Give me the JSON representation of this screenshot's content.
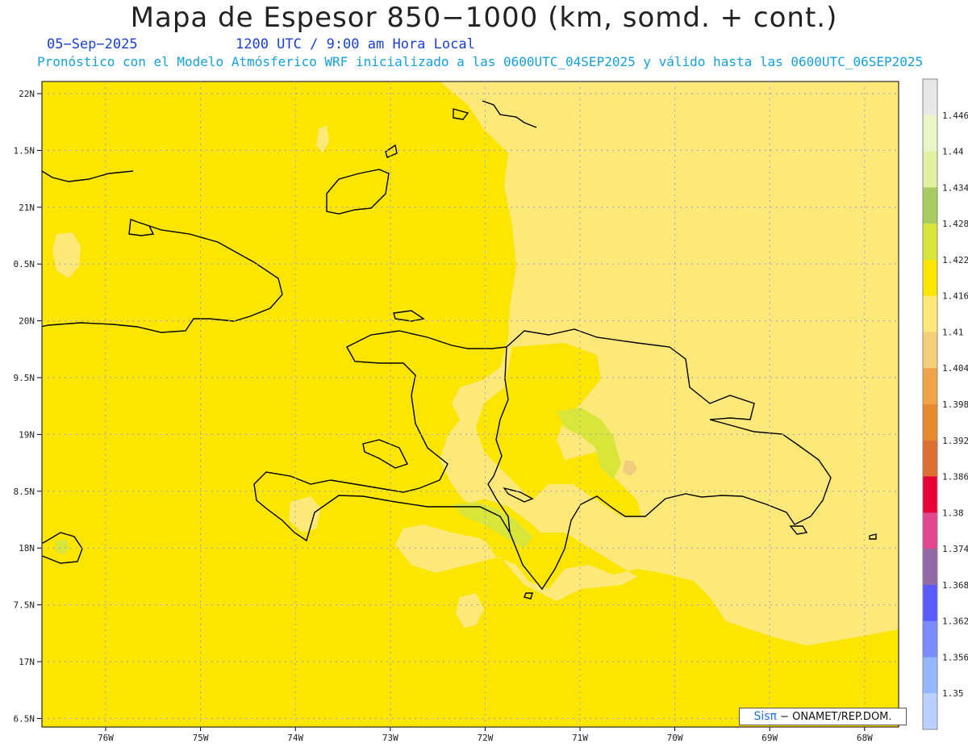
{
  "header": {
    "title": "Mapa de Espesor 850−1000 (km, somd. + cont.)",
    "date": "05−Sep−2025",
    "time": "1200 UTC / 9:00 am Hora Local",
    "subtitle": "Pronóstico con el Modelo Atmósferico WRF inicializado a las 0600UTC_04SEP2025 y válido hasta las  0600UTC_06SEP2025"
  },
  "map": {
    "lat_labels": [
      "22N",
      "1.5N",
      "21N",
      "0.5N",
      "20N",
      "9.5N",
      "19N",
      "8.5N",
      "18N",
      "7.5N",
      "17N",
      "6.5N"
    ],
    "lon_labels": [
      "76W",
      "75W",
      "74W",
      "73W",
      "72W",
      "71W",
      "70W",
      "69W",
      "68W"
    ],
    "fill_colors": {
      "base": "#fce600",
      "light": "#fde97a",
      "green": "#d8e63c",
      "tan": "#f0cc7c"
    }
  },
  "colorbar": {
    "labels": [
      "1.446",
      "1.44",
      "1.434",
      "1.428",
      "1.422",
      "1.416",
      "1.41",
      "1.404",
      "1.398",
      "1.392",
      "1.386",
      "1.38",
      "1.374",
      "1.368",
      "1.362",
      "1.356",
      "1.35"
    ],
    "colors": [
      "#e8e8e8",
      "#eaf5c8",
      "#e2f0a2",
      "#a8cc60",
      "#d8e63c",
      "#fce600",
      "#fde97a",
      "#f3cf7c",
      "#efa448",
      "#e88a30",
      "#dd7030",
      "#ea0038",
      "#e24890",
      "#946aa6",
      "#5a5aff",
      "#7c8cff",
      "#94b8ff",
      "#bcd0ff"
    ]
  },
  "credit": {
    "sistema": "Sisπ",
    "org": "− ONAMET/REP.DOM."
  }
}
